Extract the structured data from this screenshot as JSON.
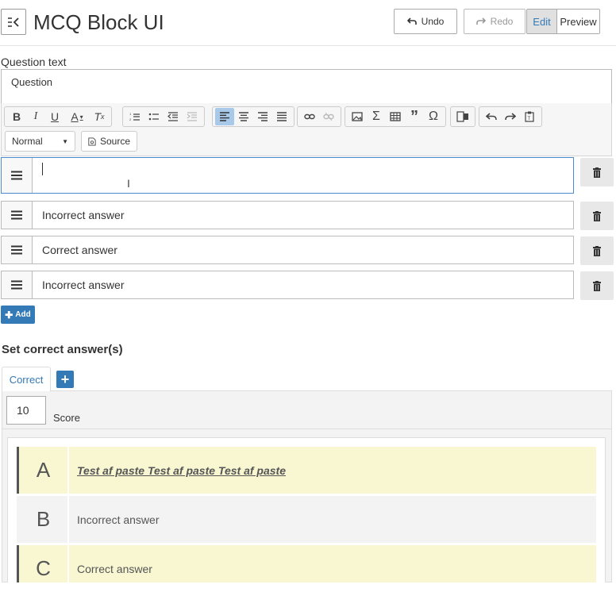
{
  "header": {
    "title": "MCQ Block UI",
    "undo_label": "Undo",
    "redo_label": "Redo",
    "edit_label": "Edit",
    "preview_label": "Preview"
  },
  "question": {
    "label": "Question text",
    "value": "Question"
  },
  "toolbar": {
    "format_value": "Normal",
    "source_label": "Source"
  },
  "answers": [
    {
      "text": ""
    },
    {
      "text": "Incorrect answer"
    },
    {
      "text": "Correct answer"
    },
    {
      "text": "Incorrect answer"
    }
  ],
  "add_label": "Add",
  "correct_section": {
    "title": "Set correct answer(s)",
    "tab_label": "Correct",
    "tab_add_icon": "+",
    "score_value": "10",
    "score_label": "Score"
  },
  "choices": [
    {
      "letter": "A",
      "text": "Test af paste Test af paste Test af paste",
      "state": "correct"
    },
    {
      "letter": "B",
      "text": "Incorrect answer",
      "state": "incorrect"
    },
    {
      "letter": "C",
      "text": "Correct answer",
      "state": "correct"
    }
  ],
  "colors": {
    "primary": "#337ab7",
    "correct_bg": "#f8f7d2",
    "active_tool": "#a9c9ea"
  }
}
